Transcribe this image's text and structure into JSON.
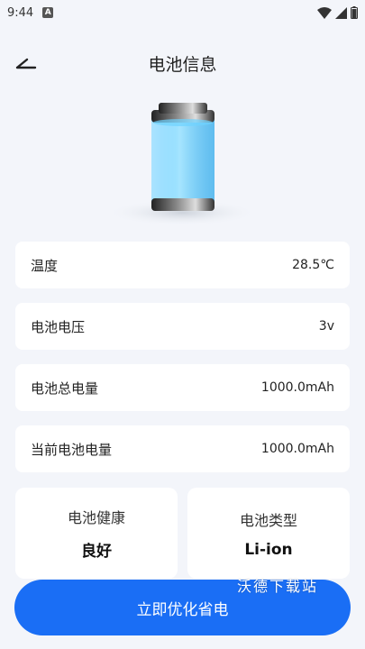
{
  "status_bar": {
    "time": "9:44",
    "badge": "A"
  },
  "header": {
    "title": "电池信息"
  },
  "colors": {
    "accent": "#1a6ef5",
    "battery_fill": "#29b6f6",
    "background": "#f3f5fa"
  },
  "info_rows": [
    {
      "label": "温度",
      "value": "28.5℃"
    },
    {
      "label": "电池电压",
      "value": "3v"
    },
    {
      "label": "电池总电量",
      "value": "1000.0mAh"
    },
    {
      "label": "当前电池电量",
      "value": "1000.0mAh"
    }
  ],
  "health_card": {
    "label": "电池健康",
    "value": "良好"
  },
  "type_card": {
    "label": "电池类型",
    "value": "Li-ion"
  },
  "watermark": "沃德下载站",
  "optimize_button": {
    "label": "立即优化省电"
  }
}
